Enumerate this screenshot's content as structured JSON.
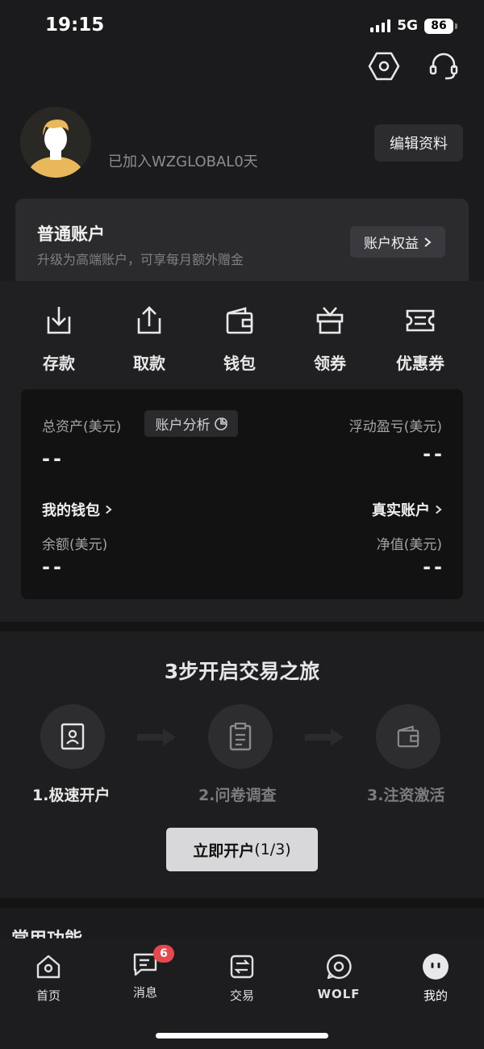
{
  "status_bar": {
    "time": "19:15",
    "network": "5G",
    "battery": "86"
  },
  "header": {
    "icons": [
      "settings-hexagon-icon",
      "headset-icon"
    ],
    "joined_text": "已加入WZGLOBAL0天",
    "edit_profile": "编辑资料"
  },
  "account_tier": {
    "title": "普通账户",
    "subtitle": "升级为高端账户，可享每月额外赠金",
    "benefits_button": "账户权益"
  },
  "quick_actions": [
    {
      "label": "存款",
      "icon": "deposit-icon"
    },
    {
      "label": "取款",
      "icon": "withdraw-icon"
    },
    {
      "label": "钱包",
      "icon": "wallet-icon"
    },
    {
      "label": "领券",
      "icon": "gift-icon"
    },
    {
      "label": "优惠券",
      "icon": "ticket-icon"
    }
  ],
  "assets": {
    "total_label": "总资产(美元)",
    "analysis_button": "账户分析",
    "total_value": "--",
    "floating_pl_label": "浮动盈亏(美元)",
    "floating_pl_value": "--",
    "wallet_link": "我的钱包",
    "balance_label": "余额(美元)",
    "balance_value": "--",
    "real_account_link": "真实账户",
    "equity_label": "净值(美元)",
    "equity_value": "--"
  },
  "onboarding": {
    "title": "3步开启交易之旅",
    "steps": [
      {
        "label": "1.极速开户",
        "active": true,
        "icon": "id-card-icon"
      },
      {
        "label": "2.问卷调查",
        "active": false,
        "icon": "clipboard-icon"
      },
      {
        "label": "3.注资激活",
        "active": false,
        "icon": "wallet-icon"
      }
    ],
    "button_label": "立即开户",
    "button_progress": "(1/3)"
  },
  "section_heading_partial": "常用功能",
  "tab_bar": {
    "tabs": [
      {
        "label": "首页",
        "icon": "home-icon"
      },
      {
        "label": "消息",
        "icon": "message-icon",
        "badge": "6"
      },
      {
        "label": "交易",
        "icon": "trade-icon"
      },
      {
        "label": "WOLF",
        "icon": "wolf-chat-icon"
      },
      {
        "label": "我的",
        "icon": "profile-icon",
        "selected": true
      }
    ]
  },
  "colors": {
    "background": "#1b1b1d",
    "badge": "#e5484d",
    "primary_button": "#d8d8da",
    "avatar_accent": "#e8b85a"
  }
}
